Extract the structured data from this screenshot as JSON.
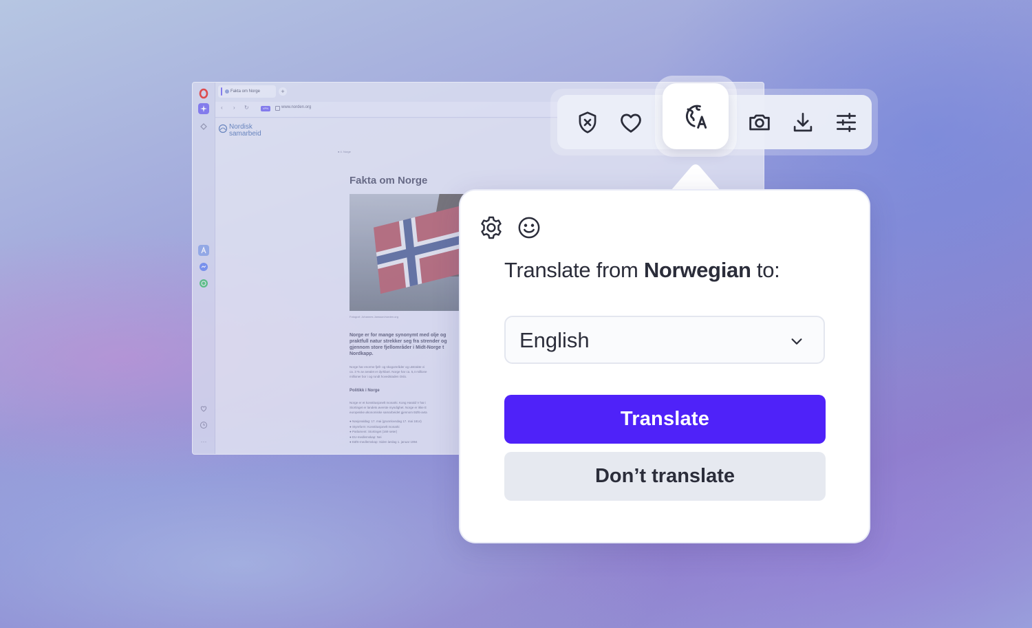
{
  "browser": {
    "tab_title": "Fakta om Norge",
    "new_tab_symbol": "+",
    "vpn_badge": "VPN",
    "url": "www.norden.org",
    "site_logo_line1": "Nordisk",
    "site_logo_line2": "samarbeid",
    "breadcrumb": "● 4. Norge",
    "article_title": "Fakta om Norge",
    "photo_caption": "Fotograf: Johannes Jansson/norden.org",
    "lead": "Norge er for mange synonymt med olje og\npraktfull natur strekker seg fra strender og\ngjennom store fjellområder i Midt-Norge t\nNordkapp.",
    "para1": "Norge har enorme fjell- og skogområder og utstrakte vi\nca. 3 % av arealet er dyrkbart. Norge har ca. 5,4 millione\nmillioner bor i og rundt hovedstaden Oslo.",
    "section_heading": "Politikk i Norge",
    "para2": "Norge er et konstitusjonelt monarki. Kong Harald V har i\nStortinget er landets øverste myndighet. Norge er ikke E\neuropeiske økonomiske samarbeidet gjennom EØS-avta",
    "bullets": "●  Nasjonaldag: 17. mai (grunnlovsdag 17. mai 1814)\n●  Styreform: Konstitusjonelt monarki\n●  Parlament: Stortinget (169 seter)\n●  EU-medlemskap: Nei\n●  EØS-medlemskap: Siden lørdag 1. januar 1994",
    "sidebar_more": "···"
  },
  "toolbar": {
    "icons": [
      "shield-x-icon",
      "heart-icon",
      "translate-globe-icon",
      "camera-icon",
      "download-icon",
      "sliders-icon"
    ]
  },
  "popup": {
    "question_prefix": "Translate from ",
    "source_language": "Norwegian",
    "question_suffix": " to:",
    "target_language": "English",
    "translate_label": "Translate",
    "dont_translate_label": "Don’t translate"
  },
  "colors": {
    "primary": "#4f22f9",
    "secondary_button": "#e6e9f0",
    "text_dark": "#2b2d3a",
    "opera_red": "#e8352f"
  }
}
